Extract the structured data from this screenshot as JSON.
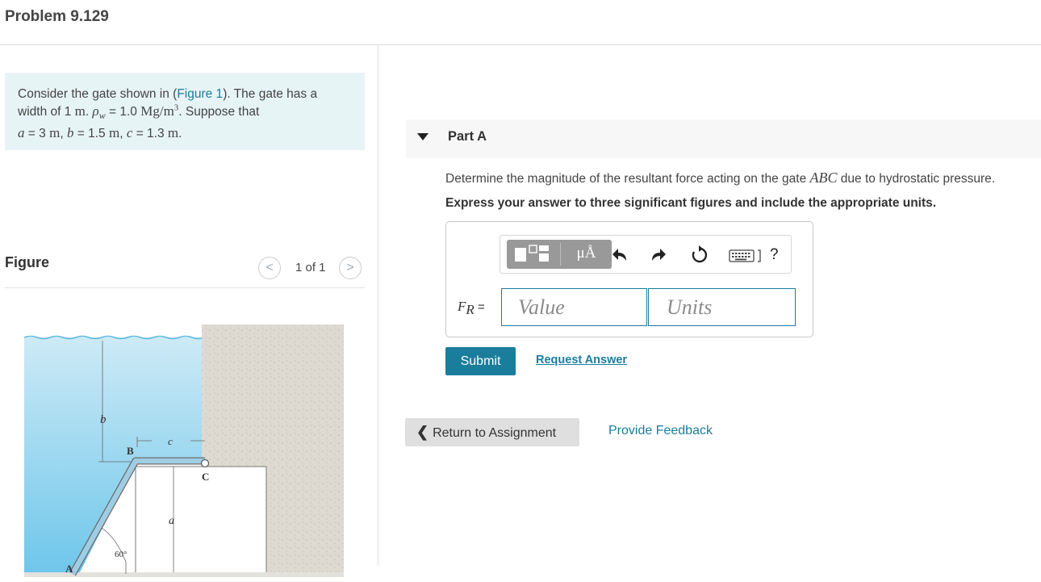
{
  "header": {
    "title": "Problem 9.129"
  },
  "intro": {
    "line1_pre": "Consider the gate shown in (",
    "figure_link": "Figure 1",
    "line1_post": "). The gate has a",
    "line2_pre": "width of 1 ",
    "unit_m": "m",
    "line2_mid": ". ",
    "rho": "ρ",
    "rho_sub": "w",
    "line2_eq": " = 1.0 ",
    "density_unit": "Mg/m",
    "density_exp": "3",
    "line2_post": ". Suppose that",
    "a_var": "a",
    "a_eq": " = 3 ",
    "b_var": "b",
    "b_eq": " = 1.5 ",
    "c_var": "c",
    "c_eq": " = 1.3 ",
    "sep": ", ",
    "end": "."
  },
  "figure": {
    "label": "Figure",
    "counter": "1 of 1",
    "prev_icon": "<",
    "next_icon": ">",
    "labels": {
      "b": "b",
      "c": "c",
      "B": "B",
      "C": "C",
      "a": "a",
      "A": "A",
      "angle": "60°"
    }
  },
  "part": {
    "title": "Part A",
    "question_pre": "Determine the magnitude of the resultant force acting on the gate ",
    "question_var": "ABC",
    "question_post": " due to hydrostatic pressure.",
    "instruction": "Express your answer to three significant figures and include the appropriate units."
  },
  "answer": {
    "label_var": "F",
    "label_sub": "R",
    "label_eq": " =",
    "value_placeholder": "Value",
    "units_placeholder": "Units",
    "toolbar": {
      "units_label": "μÅ",
      "icons": [
        "templates-icon",
        "units-icon",
        "undo-icon",
        "redo-icon",
        "reset-icon",
        "keyboard-icon",
        "help-icon"
      ],
      "help_label": "?"
    }
  },
  "actions": {
    "submit_label": "Submit",
    "request_label": "Request Answer",
    "return_icon": "❮",
    "return_label": "Return to Assignment",
    "feedback_label": "Provide Feedback"
  },
  "colors": {
    "accent": "#1b7d9c",
    "intro_bg": "#e7f4f6",
    "water": "#8fd3ef",
    "gate": "#9fcde4",
    "wall": "#dedad2"
  }
}
